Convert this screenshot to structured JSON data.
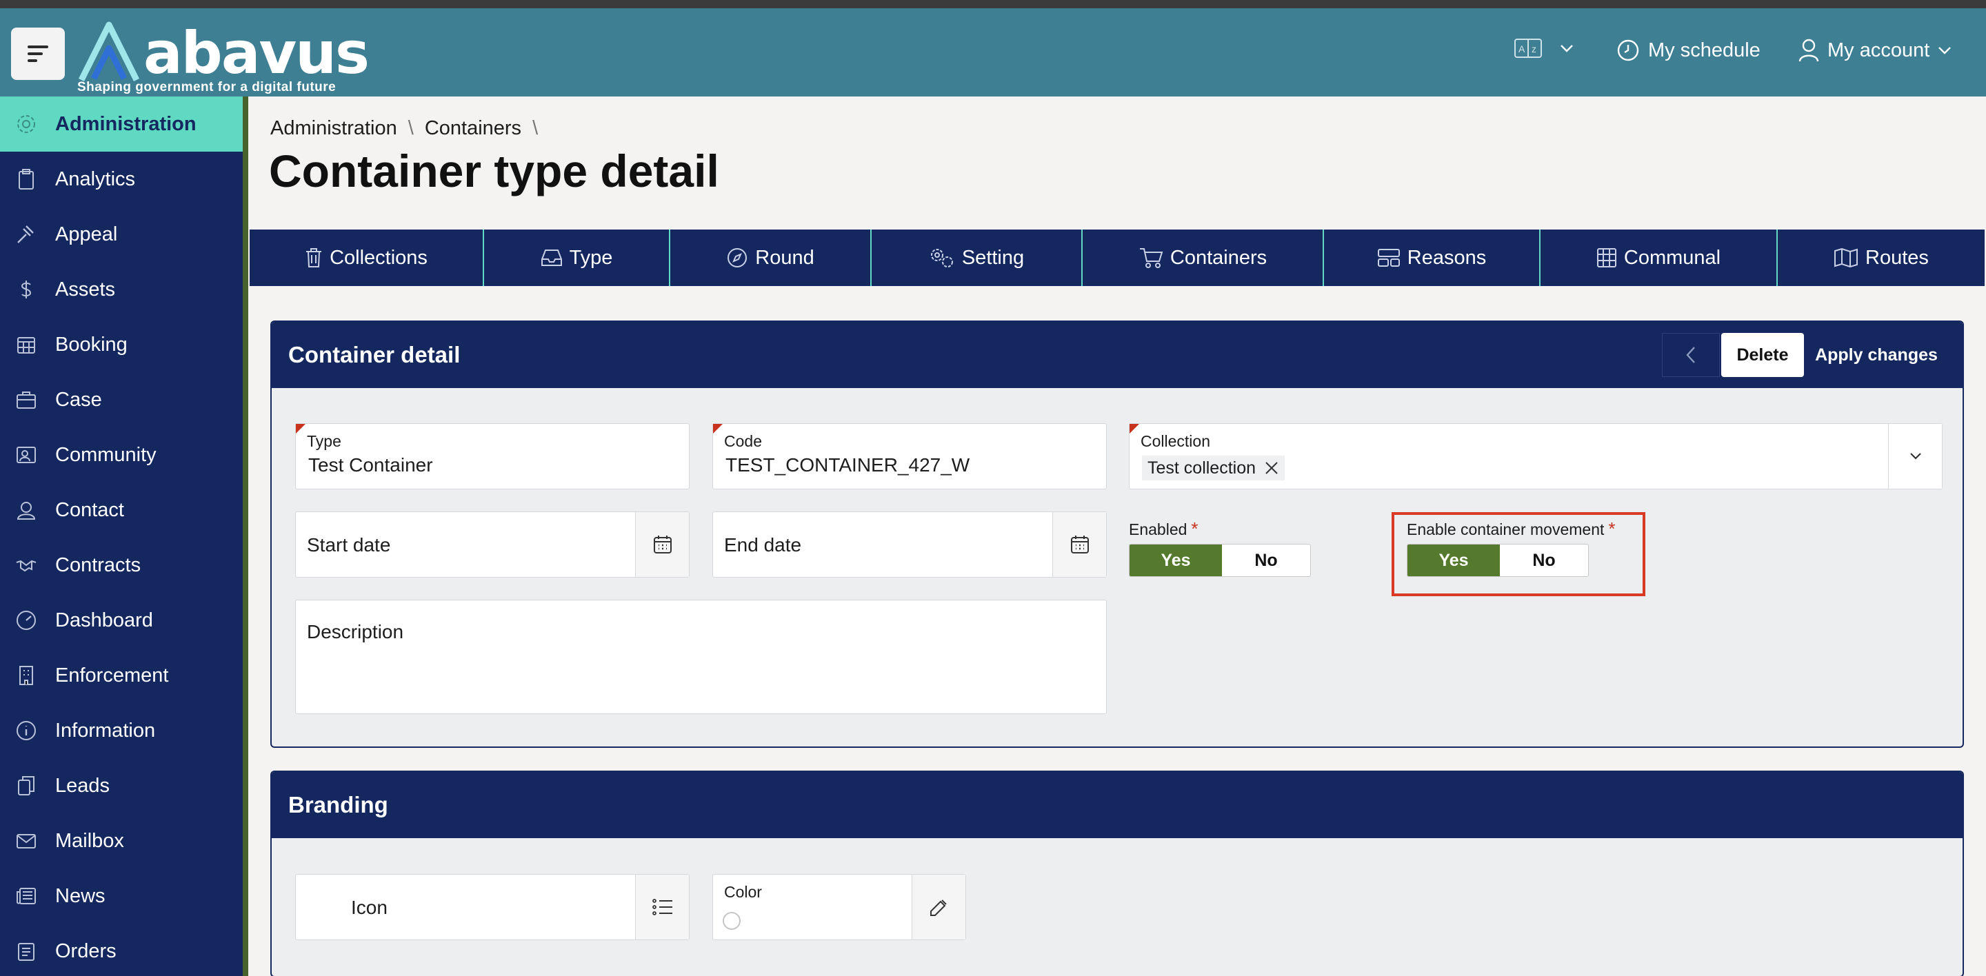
{
  "header": {
    "logo_text": "abavus",
    "tagline": "Shaping government for a digital future",
    "language_icon": "translate-icon",
    "my_schedule": "My schedule",
    "my_account": "My account"
  },
  "sidebar": {
    "items": [
      {
        "label": "Administration",
        "icon": "gear-icon"
      },
      {
        "label": "Analytics",
        "icon": "clipboard-icon"
      },
      {
        "label": "Appeal",
        "icon": "gavel-icon"
      },
      {
        "label": "Assets",
        "icon": "dollar-icon"
      },
      {
        "label": "Booking",
        "icon": "calendar-icon"
      },
      {
        "label": "Case",
        "icon": "briefcase-icon"
      },
      {
        "label": "Community",
        "icon": "community-icon"
      },
      {
        "label": "Contact",
        "icon": "contact-icon"
      },
      {
        "label": "Contracts",
        "icon": "handshake-icon"
      },
      {
        "label": "Dashboard",
        "icon": "gauge-icon"
      },
      {
        "label": "Enforcement",
        "icon": "building-icon"
      },
      {
        "label": "Information",
        "icon": "info-icon"
      },
      {
        "label": "Leads",
        "icon": "clipboard-copy-icon"
      },
      {
        "label": "Mailbox",
        "icon": "mail-icon"
      },
      {
        "label": "News",
        "icon": "newspaper-icon"
      },
      {
        "label": "Orders",
        "icon": "orders-icon"
      }
    ]
  },
  "breadcrumb": {
    "items": [
      "Administration",
      "Containers"
    ],
    "separator": "\\"
  },
  "page_title": "Container type detail",
  "tabs": [
    {
      "label": "Collections",
      "icon": "trash-icon"
    },
    {
      "label": "Type",
      "icon": "inbox-icon"
    },
    {
      "label": "Round",
      "icon": "compass-icon"
    },
    {
      "label": "Setting",
      "icon": "gears-icon"
    },
    {
      "label": "Containers",
      "icon": "cart-icon"
    },
    {
      "label": "Reasons",
      "icon": "layout-icon"
    },
    {
      "label": "Communal",
      "icon": "grid-icon"
    },
    {
      "label": "Routes",
      "icon": "map-icon"
    }
  ],
  "container_detail": {
    "title": "Container detail",
    "delete_label": "Delete",
    "apply_label": "Apply changes",
    "type_label": "Type",
    "type_value": "Test Container",
    "code_label": "Code",
    "code_value": "TEST_CONTAINER_427_W",
    "collection_label": "Collection",
    "collection_chip": "Test collection",
    "start_date_placeholder": "Start date",
    "end_date_placeholder": "End date",
    "description_placeholder": "Description",
    "enabled_label": "Enabled",
    "enabled_required": "*",
    "enabled_yes": "Yes",
    "enabled_no": "No",
    "enabled_value": "Yes",
    "movement_label": "Enable container movement",
    "movement_required": "*",
    "movement_yes": "Yes",
    "movement_no": "No",
    "movement_value": "Yes"
  },
  "branding": {
    "title": "Branding",
    "icon_placeholder": "Icon",
    "color_label": "Color"
  },
  "colors": {
    "header_bg": "#3e7f93",
    "nav_bg": "#14275f",
    "active_item": "#5fd9c1",
    "toggle_on": "#557a2e",
    "required": "#c8331d",
    "highlight": "#d93a26"
  }
}
